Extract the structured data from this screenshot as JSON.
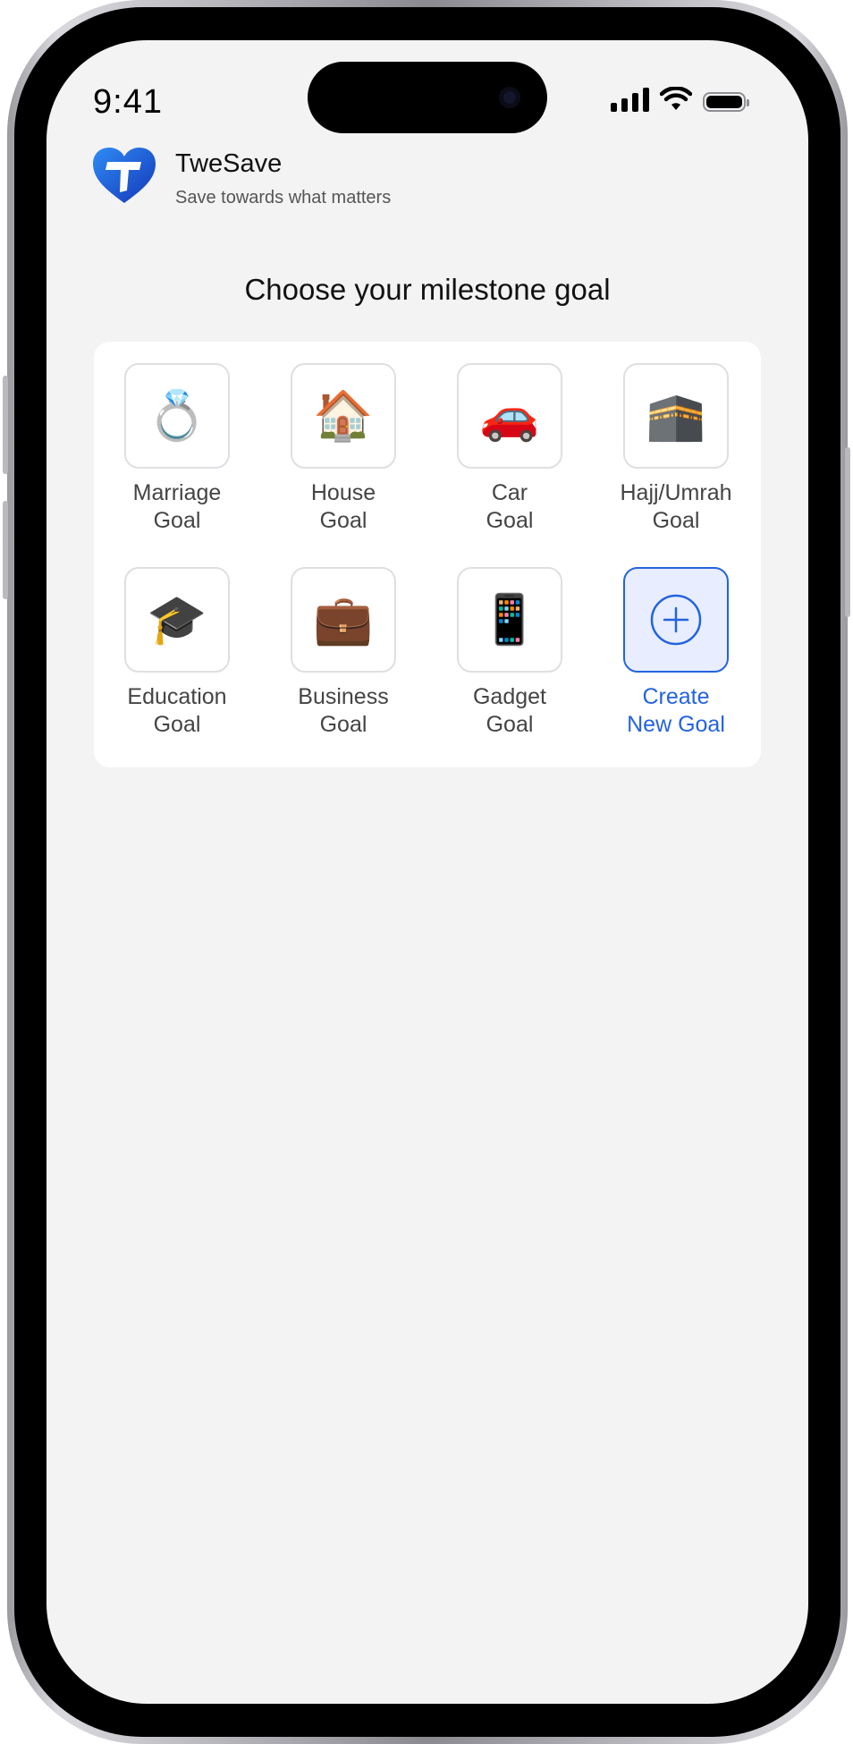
{
  "status_bar": {
    "time": "9:41"
  },
  "app": {
    "name": "TweSave",
    "tagline": "Save towards what matters"
  },
  "page": {
    "title": "Choose your milestone goal"
  },
  "goals": [
    {
      "line1": "Marriage",
      "line2": "Goal",
      "icon": "rings-icon",
      "glyph": "💍"
    },
    {
      "line1": "House",
      "line2": "Goal",
      "icon": "house-icon",
      "glyph": "🏠"
    },
    {
      "line1": "Car",
      "line2": "Goal",
      "icon": "car-icon",
      "glyph": "🚗"
    },
    {
      "line1": "Hajj/Umrah",
      "line2": "Goal",
      "icon": "kaaba-icon",
      "glyph": "🕋"
    },
    {
      "line1": "Education",
      "line2": "Goal",
      "icon": "graduation-books-icon",
      "glyph": "🎓"
    },
    {
      "line1": "Business",
      "line2": "Goal",
      "icon": "briefcase-icon",
      "glyph": "💼"
    },
    {
      "line1": "Gadget",
      "line2": "Goal",
      "icon": "smartphone-icon",
      "glyph": "📱"
    },
    {
      "line1": "Create",
      "line2": "New Goal",
      "icon": "plus-circle-icon",
      "glyph": "+"
    }
  ],
  "colors": {
    "accent": "#2463e0",
    "create_bg": "#e8eeff",
    "background": "#f3f3f4"
  }
}
